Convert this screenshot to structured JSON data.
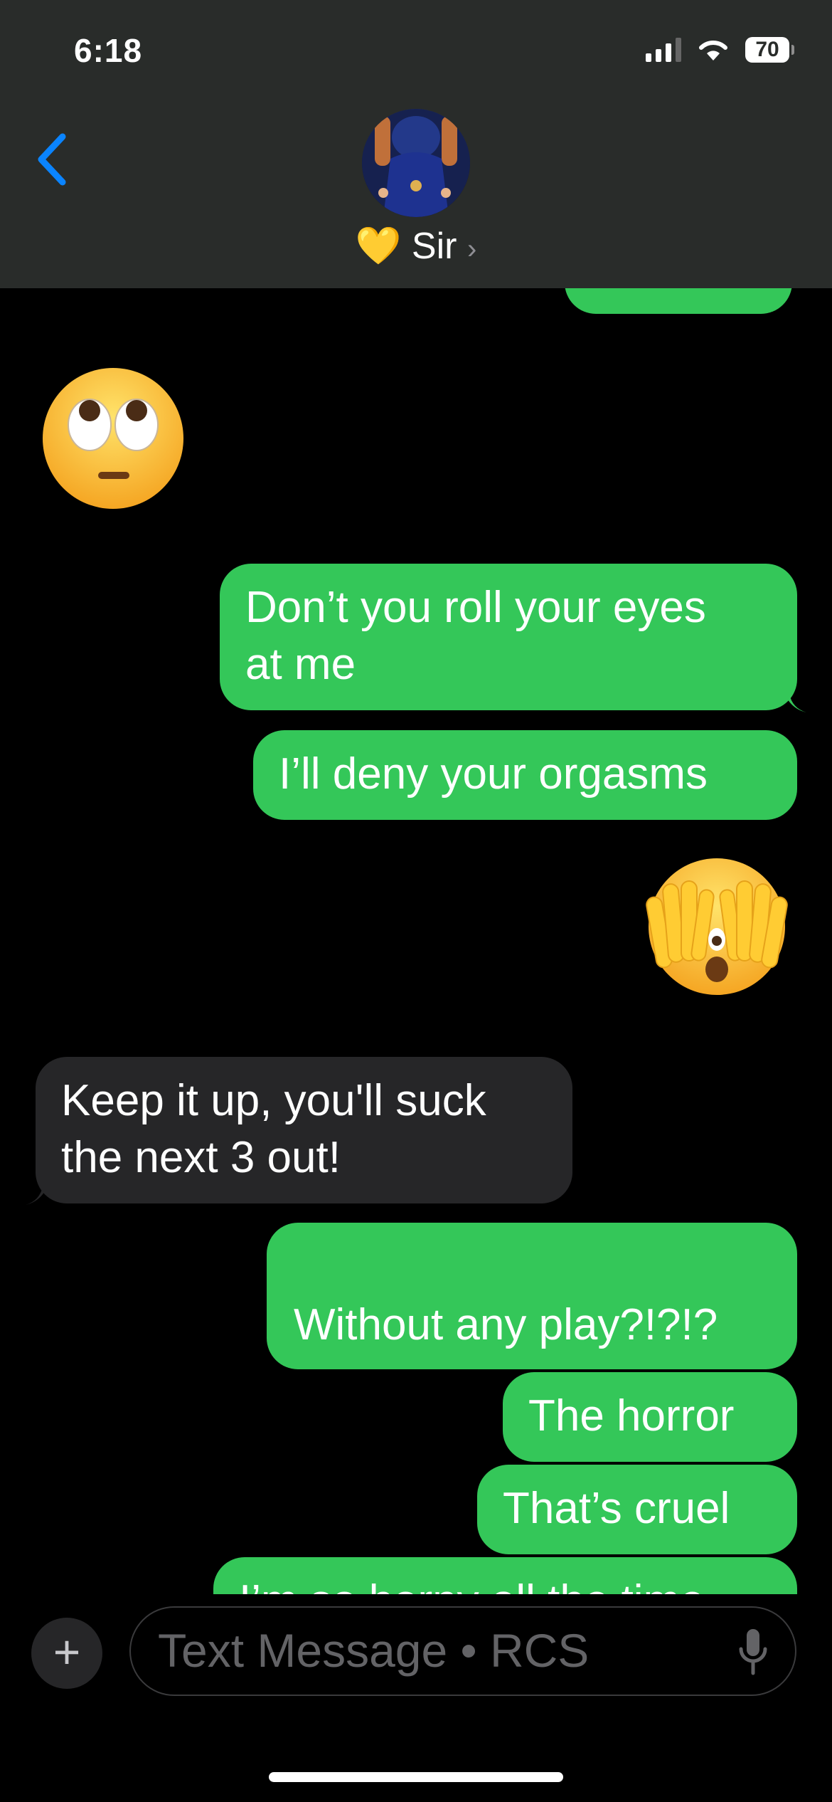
{
  "status_bar": {
    "time": "6:18",
    "battery": "70"
  },
  "header": {
    "contact_emoji": "💛",
    "contact_name": "Sir",
    "chevron": "›"
  },
  "messages": [
    {
      "from": "me",
      "text": "Don’t you roll your eyes\nat me"
    },
    {
      "from": "me",
      "text": "I’ll deny your orgasms"
    },
    {
      "from": "me",
      "emoji": "face-with-hands-over-eyes"
    },
    {
      "from": "them",
      "text": "Keep it up, you'll suck\nthe next 3 out!"
    },
    {
      "from": "me",
      "text": "Without any play?!?!?"
    },
    {
      "from": "me",
      "text": "The horror"
    },
    {
      "from": "me",
      "text": "That’s cruel"
    },
    {
      "from": "me",
      "text": "I’m so horny all the time"
    }
  ],
  "incoming_emoji": "face-with-rolling-eyes",
  "composer": {
    "plus": "+",
    "placeholder": "Text Message • RCS"
  },
  "colors": {
    "outgoing": "#34c759",
    "incoming": "#262628",
    "header": "#292c2a",
    "accent": "#0a84ff"
  }
}
